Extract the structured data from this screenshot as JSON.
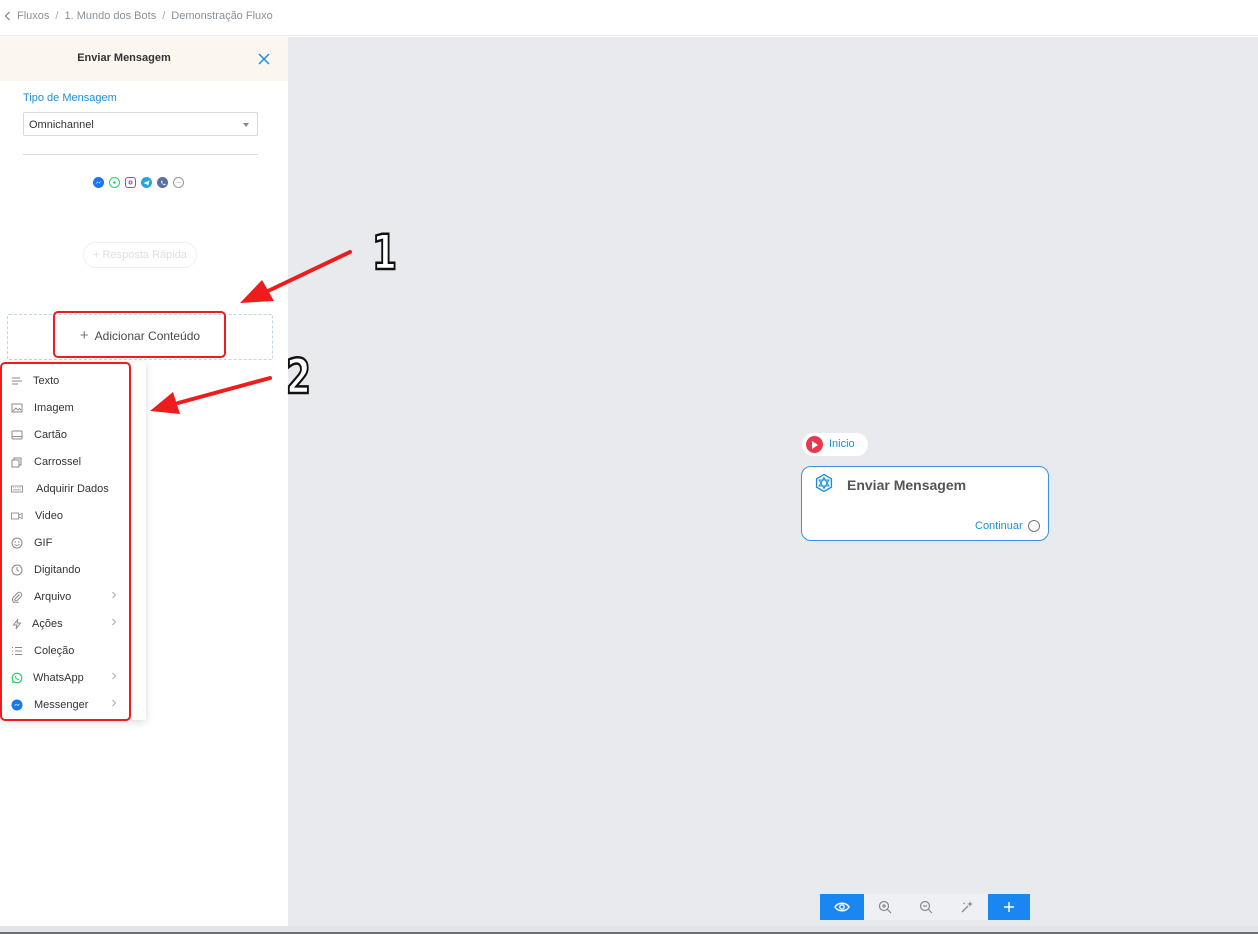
{
  "breadcrumb": {
    "items": [
      "Fluxos",
      "1. Mundo dos Bots",
      "Demonstração Fluxo"
    ],
    "separator": "/"
  },
  "panel": {
    "title": "Enviar Mensagem",
    "message_type_label": "Tipo de Mensagem",
    "message_type_value": "Omnichannel",
    "channel_icons": [
      "messenger-icon",
      "whatsapp-icon",
      "instagram-icon",
      "telegram-icon",
      "phone-icon",
      "chat-icon"
    ],
    "quick_reply_label": "+ Resposta Rápida",
    "add_content_label": "Adicionar Conteúdo"
  },
  "menu": {
    "items": [
      {
        "label": "Texto",
        "icon": "text-lines-icon",
        "has_submenu": false
      },
      {
        "label": "Imagem",
        "icon": "image-icon",
        "has_submenu": false
      },
      {
        "label": "Cartão",
        "icon": "card-icon",
        "has_submenu": false
      },
      {
        "label": "Carrossel",
        "icon": "carousel-icon",
        "has_submenu": false
      },
      {
        "label": "Adquirir Dados",
        "icon": "keyboard-icon",
        "has_submenu": false
      },
      {
        "label": "Video",
        "icon": "video-icon",
        "has_submenu": false
      },
      {
        "label": "GIF",
        "icon": "gif-icon",
        "has_submenu": false
      },
      {
        "label": "Digitando",
        "icon": "clock-icon",
        "has_submenu": false
      },
      {
        "label": "Arquivo",
        "icon": "paperclip-icon",
        "has_submenu": true
      },
      {
        "label": "Ações",
        "icon": "lightning-icon",
        "has_submenu": true
      },
      {
        "label": "Coleção",
        "icon": "list-icon",
        "has_submenu": false
      },
      {
        "label": "WhatsApp",
        "icon": "whatsapp-icon",
        "has_submenu": true
      },
      {
        "label": "Messenger",
        "icon": "messenger-icon",
        "has_submenu": true
      }
    ]
  },
  "annotations": {
    "callout_1": "1",
    "callout_2": "2"
  },
  "canvas": {
    "start_label": "Inicio",
    "node_title": "Enviar Mensagem",
    "node_continue": "Continuar"
  },
  "toolbar": {
    "buttons": [
      "eye-icon",
      "zoom-in-icon",
      "zoom-out-icon",
      "magic-wand-icon",
      "plus-icon"
    ]
  },
  "colors": {
    "accent": "#1a86f2",
    "link": "#1d8fd6",
    "annotation_red": "#ee1c1c",
    "start_red": "#e8394e",
    "canvas_bg": "#e9eaee",
    "panel_header_bg": "#fbf6ef"
  }
}
